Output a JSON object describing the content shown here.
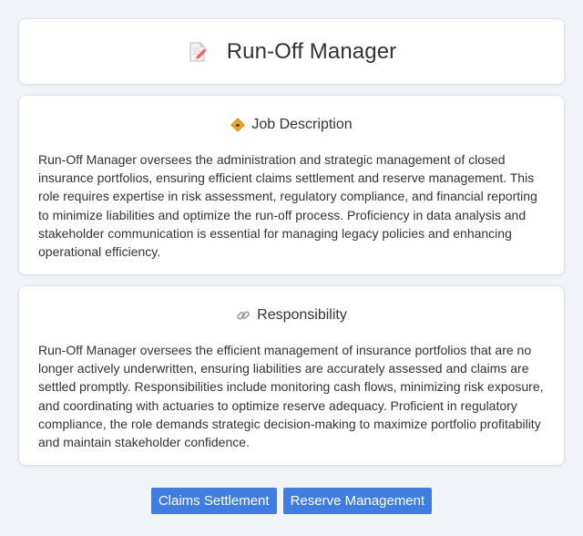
{
  "header": {
    "title": "Run-Off Manager",
    "icon": "memo-pencil-icon"
  },
  "job_description": {
    "icon": "construction-sign-icon",
    "heading": "Job Description",
    "text": "Run-Off Manager oversees the administration and strategic management of closed insurance portfolios, ensuring efficient claims settlement and reserve management. This role requires expertise in risk assessment, regulatory compliance, and financial reporting to minimize liabilities and optimize the run-off process. Proficiency in data analysis and stakeholder communication is essential for managing legacy policies and enhancing operational efficiency."
  },
  "responsibility": {
    "icon": "link-icon",
    "heading": "Responsibility",
    "text": "Run-Off Manager oversees the efficient management of insurance portfolios that are no longer actively underwritten, ensuring liabilities are accurately assessed and claims are settled promptly. Responsibilities include monitoring cash flows, minimizing risk exposure, and coordinating with actuaries to optimize reserve adequacy. Proficient in regulatory compliance, the role demands strategic decision-making to maximize portfolio profitability and maintain stakeholder confidence."
  },
  "tags": [
    {
      "label": "Claims Settlement"
    },
    {
      "label": "Reserve Management"
    }
  ],
  "colors": {
    "background": "#f0f3f8",
    "tag": "#3f7ee0"
  }
}
